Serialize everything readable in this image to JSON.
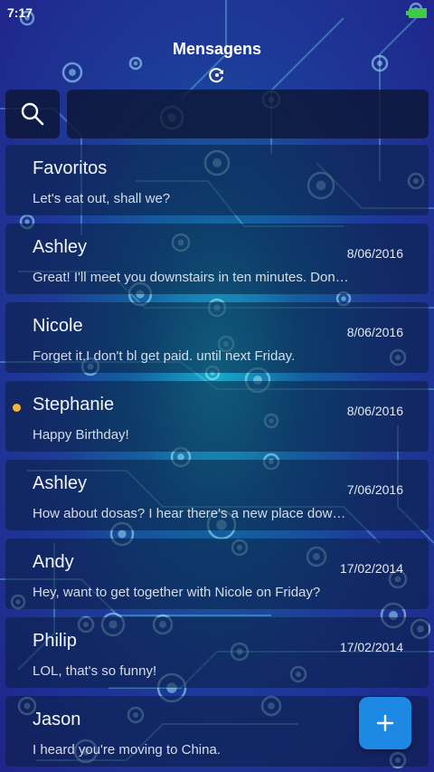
{
  "status_bar": {
    "time": "7:17"
  },
  "header": {
    "title": "Mensagens"
  },
  "search": {
    "value": "",
    "placeholder": ""
  },
  "conversations": [
    {
      "name": "Favoritos",
      "date": "",
      "preview": "Let's eat out, shall we?",
      "unread": false
    },
    {
      "name": "Ashley",
      "date": "8/06/2016",
      "preview": "Great! I'll meet you downstairs in ten minutes. Don't be late!",
      "unread": false
    },
    {
      "name": "Nicole",
      "date": "8/06/2016",
      "preview": "Forget it.I don't bl get paid. until next Friday.",
      "unread": false
    },
    {
      "name": "Stephanie",
      "date": "8/06/2016",
      "preview": "Happy Birthday!",
      "unread": true
    },
    {
      "name": "Ashley",
      "date": "7/06/2016",
      "preview": "How about dosas? I hear there's a new place downtown.",
      "unread": false
    },
    {
      "name": "Andy",
      "date": "17/02/2014",
      "preview": "Hey, want to get together with Nicole on Friday?",
      "unread": false
    },
    {
      "name": "Philip",
      "date": "17/02/2014",
      "preview": "LOL, that's so funny!",
      "unread": false
    },
    {
      "name": "Jason",
      "date": "17/",
      "preview": "I heard you're moving to China.",
      "unread": false
    }
  ],
  "colors": {
    "accent": "#1e88e5",
    "unread_dot": "#f5b63a",
    "battery": "#3ecb4a",
    "background_deep": "#20248a",
    "background_glow": "#1aa9c9"
  },
  "icons": {
    "search": "search-icon",
    "refresh": "refresh-icon",
    "compose": "plus-icon",
    "battery": "battery-icon"
  }
}
